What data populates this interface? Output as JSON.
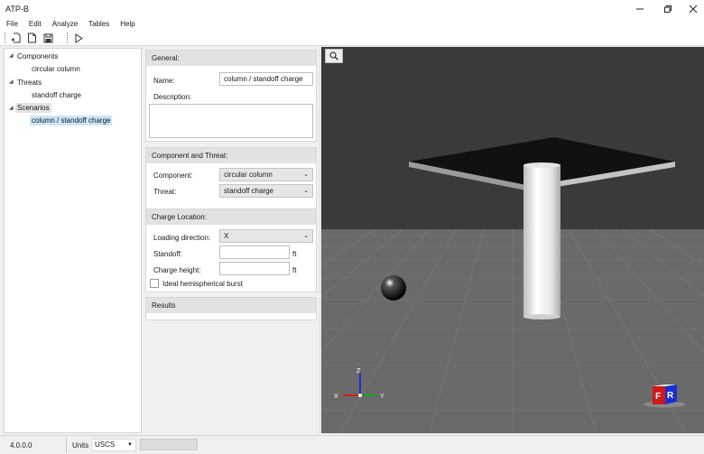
{
  "window": {
    "title": "ATP-B"
  },
  "menu": [
    "File",
    "Edit",
    "Analyze",
    "Tables",
    "Help"
  ],
  "tree": {
    "components": {
      "label": "Components",
      "children": [
        "circular column"
      ]
    },
    "threats": {
      "label": "Threats",
      "children": [
        "standoff charge"
      ]
    },
    "scenarios": {
      "label": "Scenarios",
      "children": [
        "column / standoff charge"
      ]
    }
  },
  "general": {
    "header": "General:",
    "name_label": "Name:",
    "name_value": "column / standoff charge",
    "description_label": "Description:",
    "description_value": ""
  },
  "component_threat": {
    "header": "Component and Threat:",
    "component_label": "Component:",
    "component_value": "circular column",
    "threat_label": "Threat:",
    "threat_value": "standoff charge"
  },
  "charge_location": {
    "header": "Charge Location:",
    "loading_label": "Loading direction:",
    "loading_value": "X",
    "standoff_label": "Standoff:",
    "standoff_value": "",
    "standoff_unit": "ft",
    "height_label": "Charge height:",
    "height_value": "",
    "height_unit": "ft",
    "ideal_label": "Ideal hemispherical burst",
    "ideal_checked": false
  },
  "results": {
    "header": "Results"
  },
  "viewport": {
    "axis_x": "X",
    "axis_y": "Y",
    "axis_z": "Z",
    "cube_front": "F",
    "cube_right": "R",
    "colors": {
      "sky": "#3a3a3a",
      "ground": "#6a6a6a",
      "axis_x": "#d02020",
      "axis_y": "#20a020",
      "axis_z": "#2030d0",
      "cube_front": "#d01818",
      "cube_right": "#1830d0"
    }
  },
  "status": {
    "version": "4.0.0.0",
    "units_label": "Units",
    "units_value": "USCS"
  }
}
